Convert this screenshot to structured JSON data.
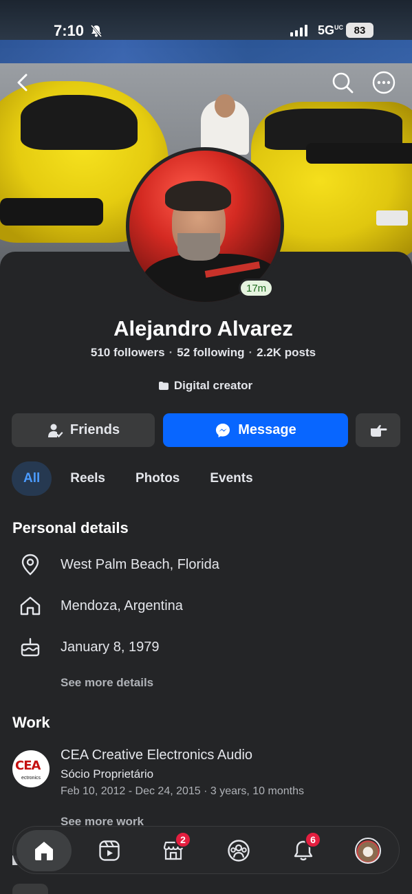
{
  "status_bar": {
    "time": "7:10",
    "network": "5G",
    "network_sup": "UC",
    "battery": "83"
  },
  "profile": {
    "name": "Alejandro Alvarez",
    "followers": "510 followers",
    "following": "52 following",
    "posts": "2.2K posts",
    "category": "Digital creator",
    "story_badge": "17m"
  },
  "actions": {
    "friends_label": "Friends",
    "message_label": "Message"
  },
  "tabs": [
    {
      "label": "All",
      "active": true
    },
    {
      "label": "Reels",
      "active": false
    },
    {
      "label": "Photos",
      "active": false
    },
    {
      "label": "Events",
      "active": false
    }
  ],
  "personal_details": {
    "title": "Personal details",
    "current_city": "West Palm Beach, Florida",
    "hometown": "Mendoza, Argentina",
    "birthday": "January 8, 1979",
    "see_more": "See more details"
  },
  "work": {
    "title": "Work",
    "company": "CEA Creative Electronics Audio",
    "logo_text": "CEA",
    "logo_subtext": "ectronics",
    "role": "Sócio Proprietário",
    "dates": "Feb 10, 2012 - Dec 24, 2015 · 3 years, 10 months",
    "see_more": "See more work"
  },
  "bottom_nav": {
    "items": [
      "home-icon",
      "video-icon",
      "marketplace-icon",
      "groups-icon",
      "notifications-icon",
      "profile-avatar"
    ],
    "marketplace_badge": "2",
    "notifications_badge": "6"
  },
  "colors": {
    "accent": "#0866ff",
    "background": "#242527",
    "button": "#3a3b3c",
    "badge": "#e41e3f",
    "tab_active_text": "#4b9bff"
  }
}
